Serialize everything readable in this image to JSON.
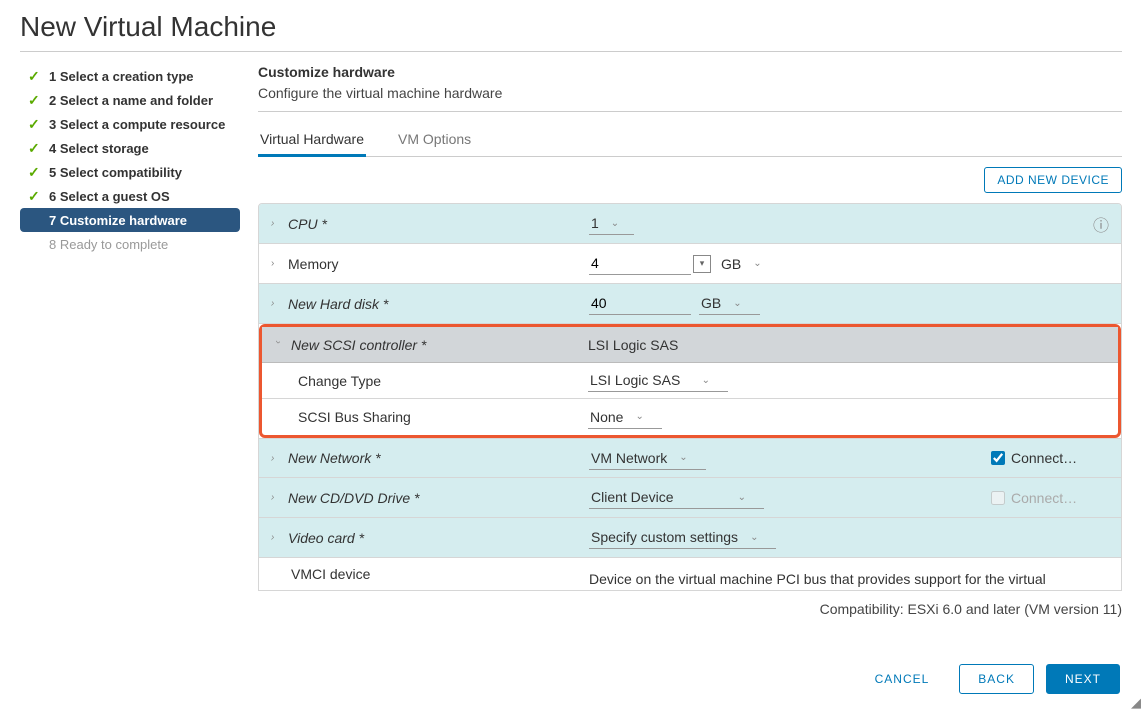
{
  "dialog": {
    "title": "New Virtual Machine"
  },
  "wizard": {
    "steps": [
      {
        "label": "1 Select a creation type",
        "state": "done"
      },
      {
        "label": "2 Select a name and folder",
        "state": "done"
      },
      {
        "label": "3 Select a compute resource",
        "state": "done"
      },
      {
        "label": "4 Select storage",
        "state": "done"
      },
      {
        "label": "5 Select compatibility",
        "state": "done"
      },
      {
        "label": "6 Select a guest OS",
        "state": "done"
      },
      {
        "label": "7 Customize hardware",
        "state": "active"
      },
      {
        "label": "8 Ready to complete",
        "state": "future"
      }
    ]
  },
  "section": {
    "title": "Customize hardware",
    "subtitle": "Configure the virtual machine hardware"
  },
  "tabs": {
    "t0": "Virtual Hardware",
    "t1": "VM Options"
  },
  "toolbar": {
    "add_device": "ADD NEW DEVICE"
  },
  "hardware": {
    "cpu": {
      "label": "CPU *",
      "value": "1"
    },
    "memory": {
      "label": "Memory",
      "value": "4",
      "unit": "GB"
    },
    "harddisk": {
      "label": "New Hard disk *",
      "value": "40",
      "unit": "GB"
    },
    "scsi": {
      "label": "New SCSI controller *",
      "value": "LSI Logic SAS",
      "change_type_label": "Change Type",
      "change_type": "LSI Logic SAS",
      "bus_sharing_label": "SCSI Bus Sharing",
      "bus_sharing": "None"
    },
    "network": {
      "label": "New Network *",
      "value": "VM Network",
      "connect": "Connect…",
      "checked": true
    },
    "cddvd": {
      "label": "New CD/DVD Drive *",
      "value": "Client Device",
      "connect": "Connect…",
      "checked": false
    },
    "video": {
      "label": "Video card *",
      "value": "Specify custom settings"
    },
    "vmci": {
      "label": "VMCI device",
      "desc": "Device on the virtual machine PCI bus that provides support for the virtual"
    }
  },
  "compat": "Compatibility: ESXi 6.0 and later (VM version 11)",
  "footer": {
    "cancel": "CANCEL",
    "back": "BACK",
    "next": "NEXT"
  }
}
